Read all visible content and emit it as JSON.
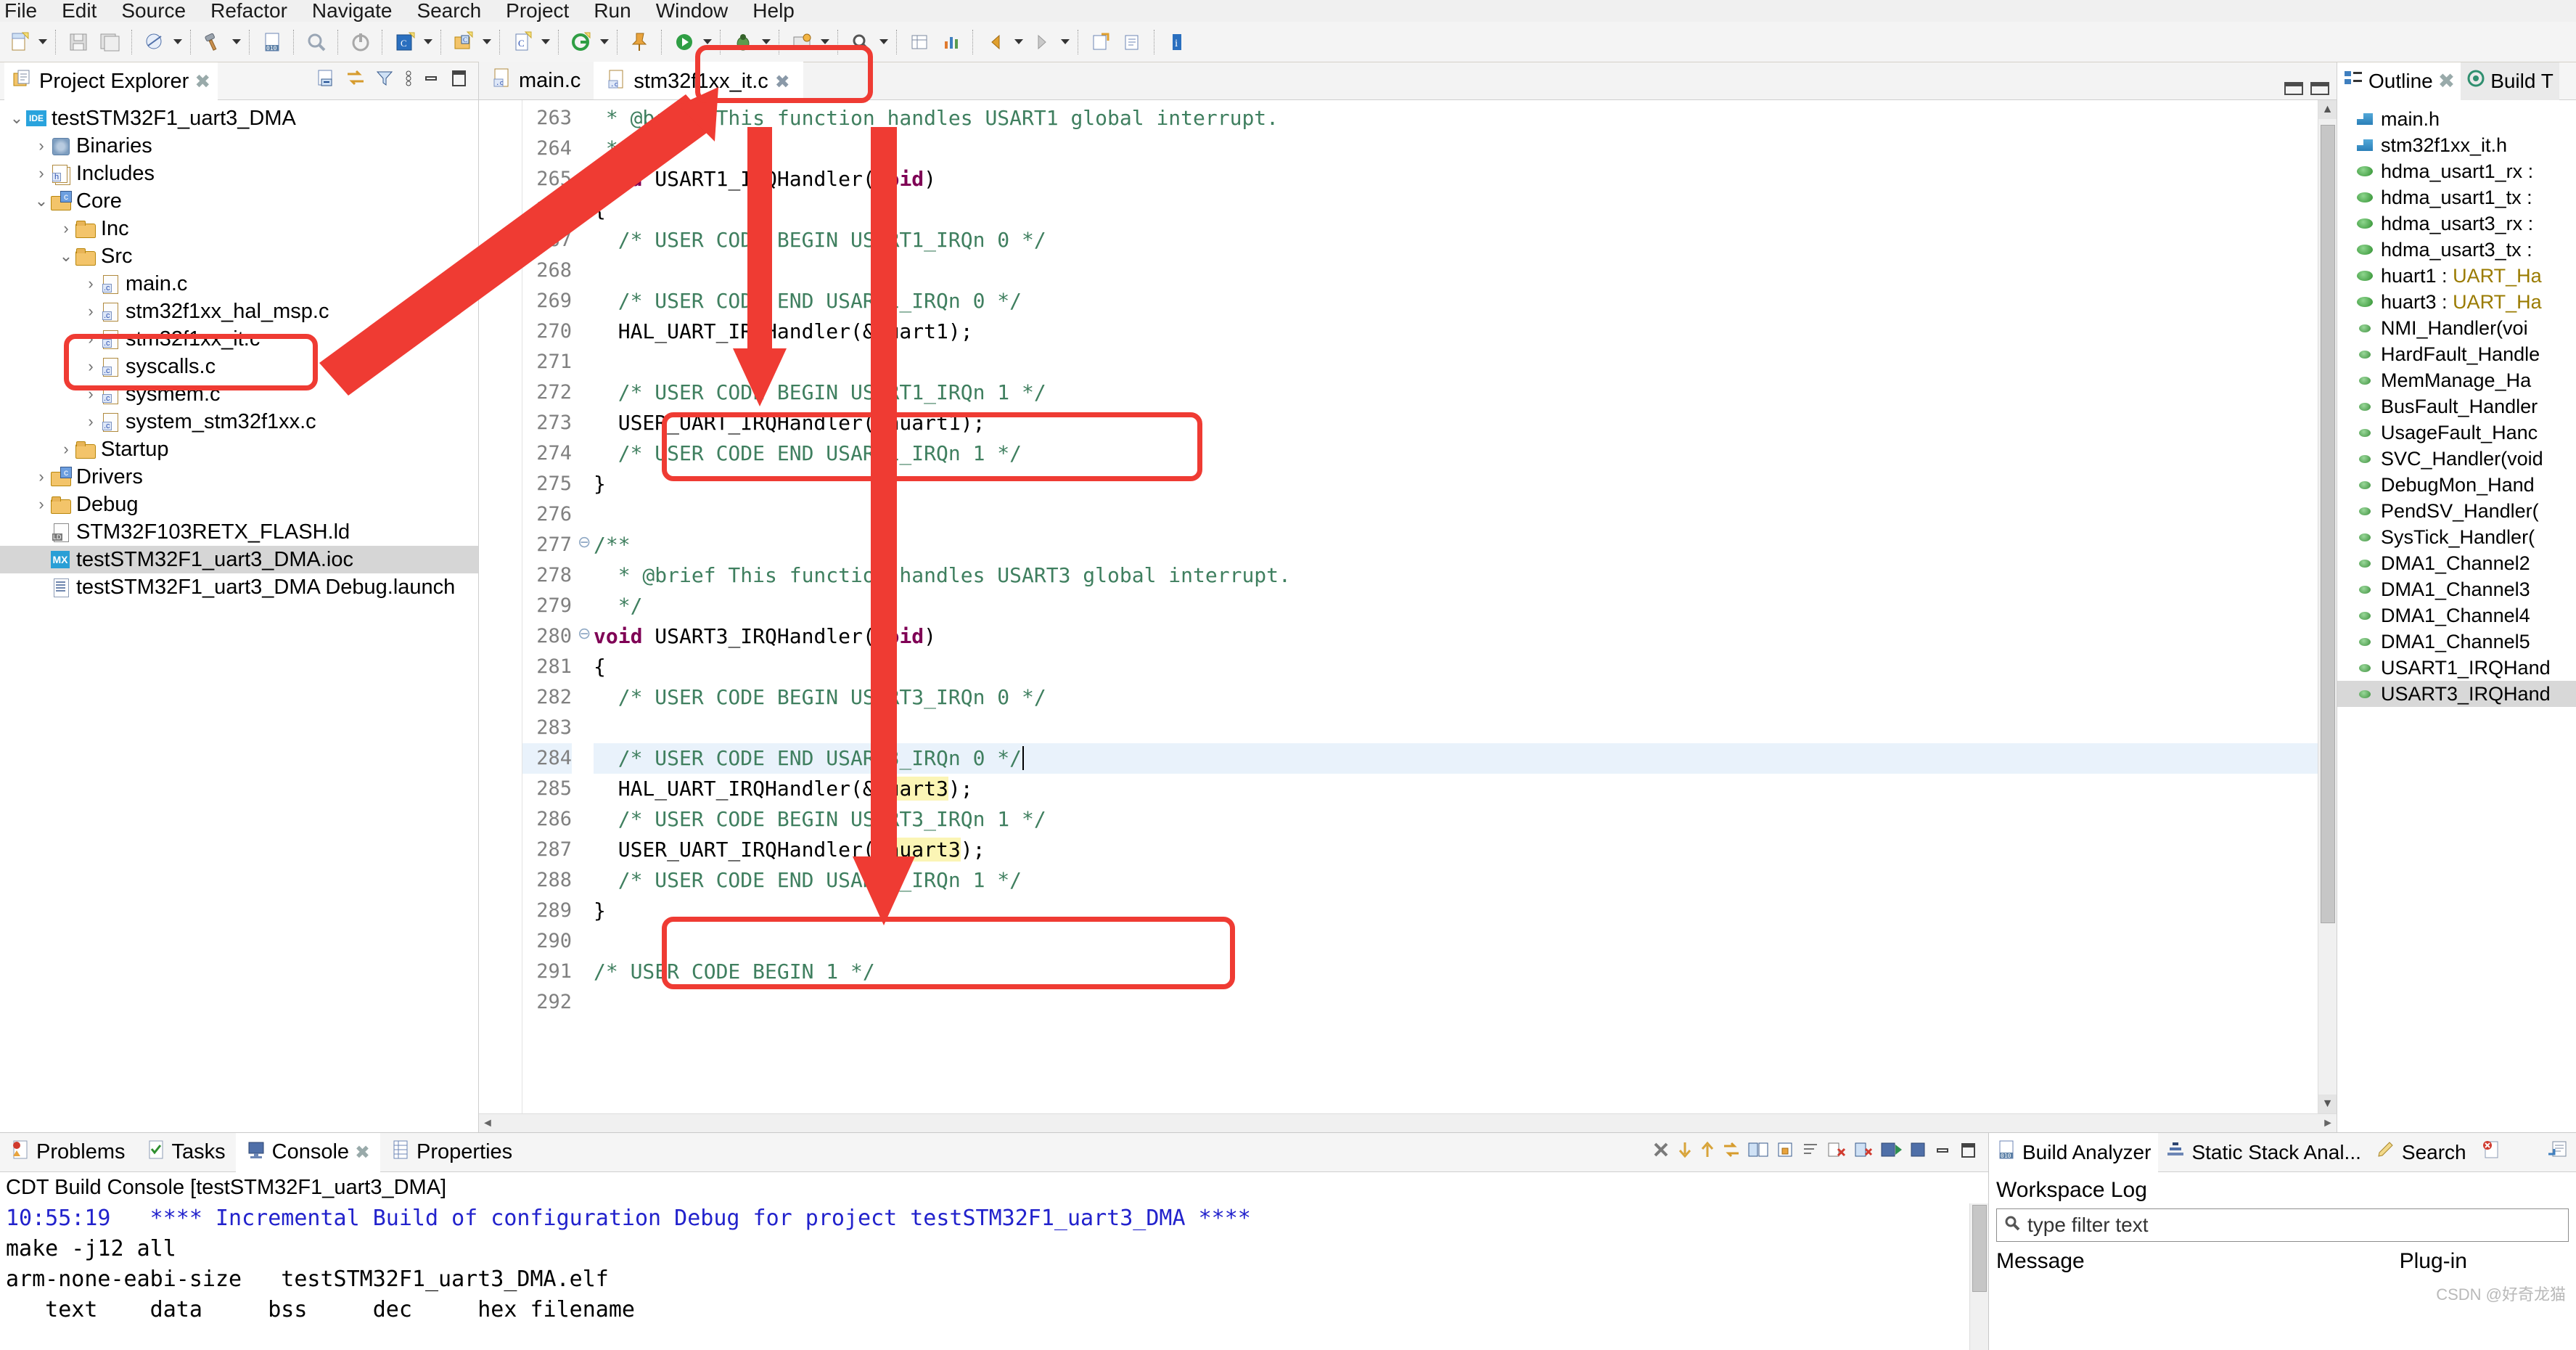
{
  "menu": {
    "items": [
      "File",
      "Edit",
      "Source",
      "Refactor",
      "Navigate",
      "Search",
      "Project",
      "Run",
      "Window",
      "Help"
    ]
  },
  "toolbar": {
    "icons": [
      "new-file-icon",
      "dropdown-arrow",
      "save-icon",
      "save-all-icon",
      "print-icon",
      "dropdown-arrow",
      "build-hammer-icon",
      "dropdown-arrow",
      "binary-010-icon",
      "debug-disabled-icon",
      "run-disabled-icon",
      "new-c-project-icon",
      "dropdown-arrow",
      "new-c-folder-icon",
      "dropdown-arrow",
      "new-c-file-icon",
      "dropdown-arrow",
      "git-icon",
      "dropdown-arrow",
      "pin-icon",
      "run-green-icon",
      "dropdown-arrow",
      "debug-bug-icon",
      "dropdown-arrow",
      "external-tools-icon",
      "dropdown-arrow",
      "search-icon",
      "dropdown-arrow",
      "table-icon",
      "chart-icon",
      "nav-back-icon",
      "dropdown-arrow",
      "nav-forward-icon",
      "dropdown-arrow",
      "link-icon",
      "open-type-icon",
      "info-icon"
    ]
  },
  "project_explorer": {
    "title": "Project Explorer",
    "close_label": "✖",
    "actions": [
      "collapse-all-icon",
      "link-with-editor-icon",
      "filter-icon",
      "view-menu-icon",
      "minimize-icon",
      "maximize-icon"
    ],
    "tree": [
      {
        "label": "testSTM32F1_uart3_DMA",
        "indent": 0,
        "twisty": "⌄",
        "icon": "ide",
        "selected": false
      },
      {
        "label": "Binaries",
        "indent": 1,
        "twisty": "›",
        "icon": "bin",
        "selected": false
      },
      {
        "label": "Includes",
        "indent": 1,
        "twisty": "›",
        "icon": "inc",
        "selected": false
      },
      {
        "label": "Core",
        "indent": 1,
        "twisty": "⌄",
        "icon": "folderc",
        "selected": false
      },
      {
        "label": "Inc",
        "indent": 2,
        "twisty": "›",
        "icon": "folder",
        "selected": false
      },
      {
        "label": "Src",
        "indent": 2,
        "twisty": "⌄",
        "icon": "folder",
        "selected": false
      },
      {
        "label": "main.c",
        "indent": 3,
        "twisty": "›",
        "icon": "file",
        "selected": false
      },
      {
        "label": "stm32f1xx_hal_msp.c",
        "indent": 3,
        "twisty": "›",
        "icon": "file",
        "selected": false
      },
      {
        "label": "stm32f1xx_it.c",
        "indent": 3,
        "twisty": "›",
        "icon": "file",
        "selected": false
      },
      {
        "label": "syscalls.c",
        "indent": 3,
        "twisty": "›",
        "icon": "file",
        "selected": false
      },
      {
        "label": "sysmem.c",
        "indent": 3,
        "twisty": "›",
        "icon": "file",
        "selected": false
      },
      {
        "label": "system_stm32f1xx.c",
        "indent": 3,
        "twisty": "›",
        "icon": "file",
        "selected": false
      },
      {
        "label": "Startup",
        "indent": 2,
        "twisty": "›",
        "icon": "folder",
        "selected": false
      },
      {
        "label": "Drivers",
        "indent": 1,
        "twisty": "›",
        "icon": "folderc",
        "selected": false
      },
      {
        "label": "Debug",
        "indent": 1,
        "twisty": "›",
        "icon": "folder",
        "selected": false
      },
      {
        "label": "STM32F103RETX_FLASH.ld",
        "indent": 1,
        "twisty": "",
        "icon": "ld",
        "selected": false
      },
      {
        "label": "testSTM32F1_uart3_DMA.ioc",
        "indent": 1,
        "twisty": "",
        "icon": "mx",
        "selected": true
      },
      {
        "label": "testSTM32F1_uart3_DMA Debug.launch",
        "indent": 1,
        "twisty": "",
        "icon": "launch",
        "selected": false
      }
    ]
  },
  "editor": {
    "tabs": [
      {
        "label": "main.c",
        "active": false,
        "icon": "c-file-icon"
      },
      {
        "label": "stm32f1xx_it.c",
        "active": true,
        "icon": "c-file-icon"
      }
    ],
    "first_line_number": 263,
    "lines": [
      {
        "n": 263,
        "fold": "",
        "text": " * @brief This function handles USART1 global interrupt.",
        "style": "cmt",
        "hl": false
      },
      {
        "n": 264,
        "fold": "",
        "text": " */",
        "style": "cmt",
        "hl": false
      },
      {
        "n": 265,
        "fold": "⊖",
        "text": "void USART1_IRQHandler(void)",
        "style": "decl",
        "hl": false
      },
      {
        "n": 266,
        "fold": "",
        "text": "{",
        "style": "plain",
        "hl": false
      },
      {
        "n": 267,
        "fold": "",
        "text": "  /* USER CODE BEGIN USART1_IRQn 0 */",
        "style": "cmt",
        "hl": false
      },
      {
        "n": 268,
        "fold": "",
        "text": "",
        "style": "plain",
        "hl": false
      },
      {
        "n": 269,
        "fold": "",
        "text": "  /* USER CODE END USART1_IRQn 0 */",
        "style": "cmt",
        "hl": false
      },
      {
        "n": 270,
        "fold": "",
        "text": "  HAL_UART_IRQHandler(&huart1);",
        "style": "plain",
        "hl": false
      },
      {
        "n": 271,
        "fold": "",
        "text": "",
        "style": "plain",
        "hl": false
      },
      {
        "n": 272,
        "fold": "",
        "text": "  /* USER CODE BEGIN USART1_IRQn 1 */",
        "style": "cmt",
        "hl": false
      },
      {
        "n": 273,
        "fold": "",
        "text": "  USER_UART_IRQHandler(&huart1);",
        "style": "plain",
        "hl": false
      },
      {
        "n": 274,
        "fold": "",
        "text": "  /* USER CODE END USART1_IRQn 1 */",
        "style": "cmt",
        "hl": false
      },
      {
        "n": 275,
        "fold": "",
        "text": "}",
        "style": "plain",
        "hl": false
      },
      {
        "n": 276,
        "fold": "",
        "text": "",
        "style": "plain",
        "hl": false
      },
      {
        "n": 277,
        "fold": "⊖",
        "text": "/**",
        "style": "cmt",
        "hl": false
      },
      {
        "n": 278,
        "fold": "",
        "text": "  * @brief This function handles USART3 global interrupt.",
        "style": "cmt",
        "hl": false
      },
      {
        "n": 279,
        "fold": "",
        "text": "  */",
        "style": "cmt",
        "hl": false
      },
      {
        "n": 280,
        "fold": "⊖",
        "text": "void USART3_IRQHandler(void)",
        "style": "decl",
        "hl": false
      },
      {
        "n": 281,
        "fold": "",
        "text": "{",
        "style": "plain",
        "hl": false
      },
      {
        "n": 282,
        "fold": "",
        "text": "  /* USER CODE BEGIN USART3_IRQn 0 */",
        "style": "cmt",
        "hl": false
      },
      {
        "n": 283,
        "fold": "",
        "text": "",
        "style": "plain",
        "hl": false
      },
      {
        "n": 284,
        "fold": "",
        "text": "  /* USER CODE END USART3_IRQn 0 */",
        "style": "cmt",
        "hl": true
      },
      {
        "n": 285,
        "fold": "",
        "text": "  HAL_UART_IRQHandler(&huart3);",
        "style": "occ3",
        "hl": false
      },
      {
        "n": 286,
        "fold": "",
        "text": "  /* USER CODE BEGIN USART3_IRQn 1 */",
        "style": "cmt",
        "hl": false
      },
      {
        "n": 287,
        "fold": "",
        "text": "  USER_UART_IRQHandler(&huart3);",
        "style": "occ3",
        "hl": false
      },
      {
        "n": 288,
        "fold": "",
        "text": "  /* USER CODE END USART3_IRQn 1 */",
        "style": "cmt",
        "hl": false
      },
      {
        "n": 289,
        "fold": "",
        "text": "}",
        "style": "plain",
        "hl": false
      },
      {
        "n": 290,
        "fold": "",
        "text": "",
        "style": "plain",
        "hl": false
      },
      {
        "n": 291,
        "fold": "",
        "text": "/* USER CODE BEGIN 1 */",
        "style": "cmt",
        "hl": false
      },
      {
        "n": 292,
        "fold": "",
        "text": "",
        "style": "plain",
        "hl": false
      }
    ]
  },
  "outline": {
    "tabs": [
      {
        "label": "Outline",
        "active": true,
        "icon": "outline-icon"
      },
      {
        "label": "Build T",
        "active": false,
        "icon": "build-targets-icon"
      }
    ],
    "close_label": "✖",
    "items": [
      {
        "label": "main.h",
        "kind": "hdr",
        "selected": false,
        "type": ""
      },
      {
        "label": "stm32f1xx_it.h",
        "kind": "hdr",
        "selected": false,
        "type": ""
      },
      {
        "label": "hdma_usart1_rx :",
        "kind": "var",
        "selected": false,
        "type": ""
      },
      {
        "label": "hdma_usart1_tx :",
        "kind": "var",
        "selected": false,
        "type": ""
      },
      {
        "label": "hdma_usart3_rx :",
        "kind": "var",
        "selected": false,
        "type": ""
      },
      {
        "label": "hdma_usart3_tx :",
        "kind": "var",
        "selected": false,
        "type": ""
      },
      {
        "label": "huart1 : ",
        "kind": "var",
        "selected": false,
        "type": "UART_Ha"
      },
      {
        "label": "huart3 : ",
        "kind": "var",
        "selected": false,
        "type": "UART_Ha"
      },
      {
        "label": "NMI_Handler(voi",
        "kind": "fn",
        "selected": false,
        "type": ""
      },
      {
        "label": "HardFault_Handle",
        "kind": "fn",
        "selected": false,
        "type": ""
      },
      {
        "label": "MemManage_Ha",
        "kind": "fn",
        "selected": false,
        "type": ""
      },
      {
        "label": "BusFault_Handler",
        "kind": "fn",
        "selected": false,
        "type": ""
      },
      {
        "label": "UsageFault_Hanc",
        "kind": "fn",
        "selected": false,
        "type": ""
      },
      {
        "label": "SVC_Handler(void",
        "kind": "fn",
        "selected": false,
        "type": ""
      },
      {
        "label": "DebugMon_Hand",
        "kind": "fn",
        "selected": false,
        "type": ""
      },
      {
        "label": "PendSV_Handler(",
        "kind": "fn",
        "selected": false,
        "type": ""
      },
      {
        "label": "SysTick_Handler(",
        "kind": "fn",
        "selected": false,
        "type": ""
      },
      {
        "label": "DMA1_Channel2",
        "kind": "fn",
        "selected": false,
        "type": ""
      },
      {
        "label": "DMA1_Channel3",
        "kind": "fn",
        "selected": false,
        "type": ""
      },
      {
        "label": "DMA1_Channel4",
        "kind": "fn",
        "selected": false,
        "type": ""
      },
      {
        "label": "DMA1_Channel5",
        "kind": "fn",
        "selected": false,
        "type": ""
      },
      {
        "label": "USART1_IRQHand",
        "kind": "fn",
        "selected": false,
        "type": ""
      },
      {
        "label": "USART3_IRQHand",
        "kind": "fn",
        "selected": true,
        "type": ""
      }
    ]
  },
  "console": {
    "tabs": [
      {
        "label": "Problems",
        "active": false,
        "icon": "problems-icon"
      },
      {
        "label": "Tasks",
        "active": false,
        "icon": "tasks-icon"
      },
      {
        "label": "Console",
        "active": true,
        "icon": "console-icon"
      },
      {
        "label": "Properties",
        "active": false,
        "icon": "properties-icon"
      }
    ],
    "close_label": "✖",
    "actions": [
      "terminate-icon",
      "scroll-down-icon",
      "scroll-up-icon",
      "link-icon",
      "display-selected-console-icon",
      "lock-icon",
      "clear-icon",
      "remove-icon",
      "remove-all-icon",
      "open-console-icon",
      "pin-console-icon",
      "minimize-icon",
      "maximize-icon"
    ],
    "title": "CDT Build Console [testSTM32F1_uart3_DMA]",
    "lines": [
      {
        "text": "10:55:19   **** Incremental Build of configuration Debug for project testSTM32F1_uart3_DMA ****",
        "color": "blue"
      },
      {
        "text": "make -j12 all",
        "color": "black"
      },
      {
        "text": "arm-none-eabi-size   testSTM32F1_uart3_DMA.elf",
        "color": "black"
      },
      {
        "text": "   text    data     bss     dec     hex filename",
        "color": "black"
      }
    ]
  },
  "bottom_right": {
    "tabs": [
      {
        "label": "Build Analyzer",
        "active": true,
        "icon": "build-analyzer-icon"
      },
      {
        "label": "Static Stack Anal...",
        "active": false,
        "icon": "static-stack-icon"
      },
      {
        "label": "Search",
        "active": false,
        "icon": "search-icon"
      },
      {
        "label": "",
        "active": false,
        "icon": "error-log-icon"
      }
    ],
    "title": "Workspace Log",
    "filter_placeholder": "type filter text",
    "columns": [
      "Message",
      "Plug-in"
    ],
    "view_menu_icon": "view-menu-icon"
  },
  "watermark": "CSDN @好奇龙猫",
  "colors": {
    "annotation_red": "#ef3b33",
    "comment_green": "#3f7f5f",
    "keyword_purple": "#7f0055",
    "selection_gray": "#d6d6d6",
    "line_highlight": "#e9f2fb",
    "occurrence_yellow": "#fbf5b5"
  }
}
